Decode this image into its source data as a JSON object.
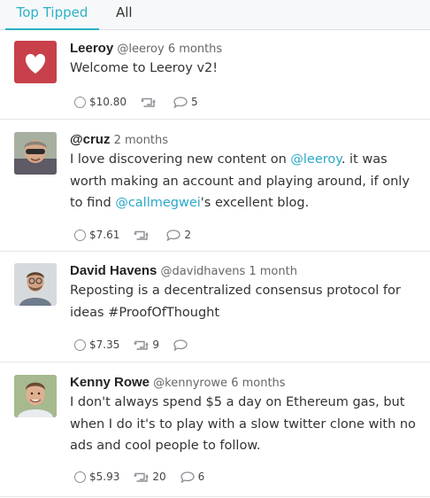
{
  "tabs": [
    {
      "label": "Top Tipped",
      "active": true
    },
    {
      "label": "All",
      "active": false
    }
  ],
  "colors": {
    "accent": "#2bb3c6",
    "mention": "#2aa8c9",
    "leeroy_brand": "#c8404a"
  },
  "posts": [
    {
      "name": "Leeroy",
      "handle": "@leeroy",
      "time": "6 months",
      "avatar_icon": "heart-icon",
      "body_parts": [
        "Welcome to Leeroy v2!"
      ],
      "tips": "$10.80",
      "reposts": "",
      "comments": "5"
    },
    {
      "name": "@cruz",
      "handle": "",
      "time": "2 months",
      "avatar_icon": "user-photo",
      "body_parts": [
        "I love discovering new content on ",
        "@leeroy",
        ". it was worth making an account and playing around, if only to find ",
        "@callmegwei",
        "'s excellent blog."
      ],
      "tips": "$7.61",
      "reposts": "",
      "comments": "2"
    },
    {
      "name": "David Havens",
      "handle": "@davidhavens",
      "time": "1 month",
      "avatar_icon": "user-photo",
      "body_parts": [
        "Reposting is a decentralized consensus protocol for ideas #ProofOfThought"
      ],
      "tips": "$7.35",
      "reposts": "9",
      "comments": ""
    },
    {
      "name": "Kenny Rowe",
      "handle": "@kennyrowe",
      "time": "6 months",
      "avatar_icon": "user-photo",
      "body_parts": [
        "I don't always spend $5 a day on Ethereum gas, but when I do it's to play with a slow twitter clone with no ads and cool people to follow."
      ],
      "tips": "$5.93",
      "reposts": "20",
      "comments": "6"
    }
  ]
}
